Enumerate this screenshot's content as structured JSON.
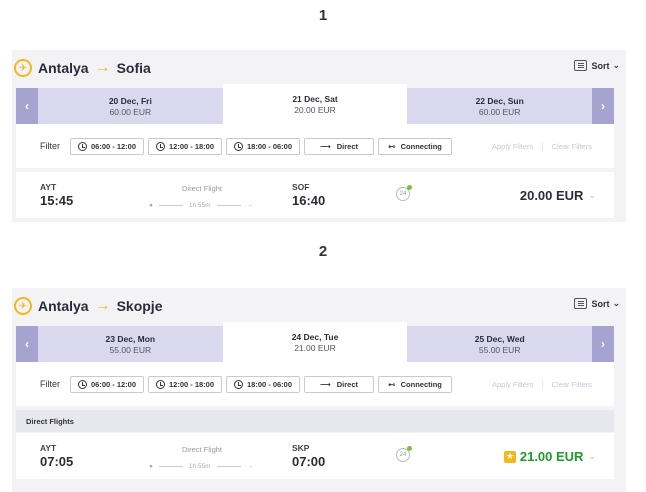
{
  "sections": [
    {
      "number": "1",
      "route": {
        "from": "Antalya",
        "to": "Sofia"
      },
      "sort_label": "Sort",
      "dates": {
        "prev": {
          "day": "20 Dec, Fri",
          "price": "60.00 EUR"
        },
        "current": {
          "day": "21 Dec, Sat",
          "price": "20.00 EUR"
        },
        "next": {
          "day": "22 Dec, Sun",
          "price": "60.00 EUR"
        }
      },
      "filters": {
        "label": "Filter",
        "chips": [
          "06:00 - 12:00",
          "12:00 - 18:00",
          "18:00 - 06:00",
          "Direct",
          "Connecting"
        ],
        "apply": "Apply Filters",
        "clear": "Clear Filters"
      },
      "flight": {
        "dep_code": "AYT",
        "dep_time": "15:45",
        "type": "Direct Flight",
        "duration": "1h 55m",
        "arr_code": "SOF",
        "arr_time": "16:40",
        "co2": "24",
        "price": "20.00 EUR"
      }
    },
    {
      "number": "2",
      "route": {
        "from": "Antalya",
        "to": "Skopje"
      },
      "sort_label": "Sort",
      "dates": {
        "prev": {
          "day": "23 Dec, Mon",
          "price": "55.00 EUR"
        },
        "current": {
          "day": "24 Dec, Tue",
          "price": "21.00 EUR"
        },
        "next": {
          "day": "25 Dec, Wed",
          "price": "55.00 EUR"
        }
      },
      "filters": {
        "label": "Filter",
        "chips": [
          "06:00 - 12:00",
          "12:00 - 18:00",
          "18:00 - 06:00",
          "Direct",
          "Connecting"
        ],
        "apply": "Apply Filters",
        "clear": "Clear Filters"
      },
      "direct_header": "Direct Flights",
      "flight": {
        "dep_code": "AYT",
        "dep_time": "07:05",
        "type": "Direct Flight",
        "duration": "1h 55m",
        "arr_code": "SKP",
        "arr_time": "07:00",
        "co2": "24",
        "price": "21.00 EUR"
      }
    }
  ],
  "colors": {
    "accent": "#f5b81c",
    "date_nav": "#a7a3d0",
    "date_cell": "#d9d8ee",
    "price_green": "#1d9a2a"
  }
}
